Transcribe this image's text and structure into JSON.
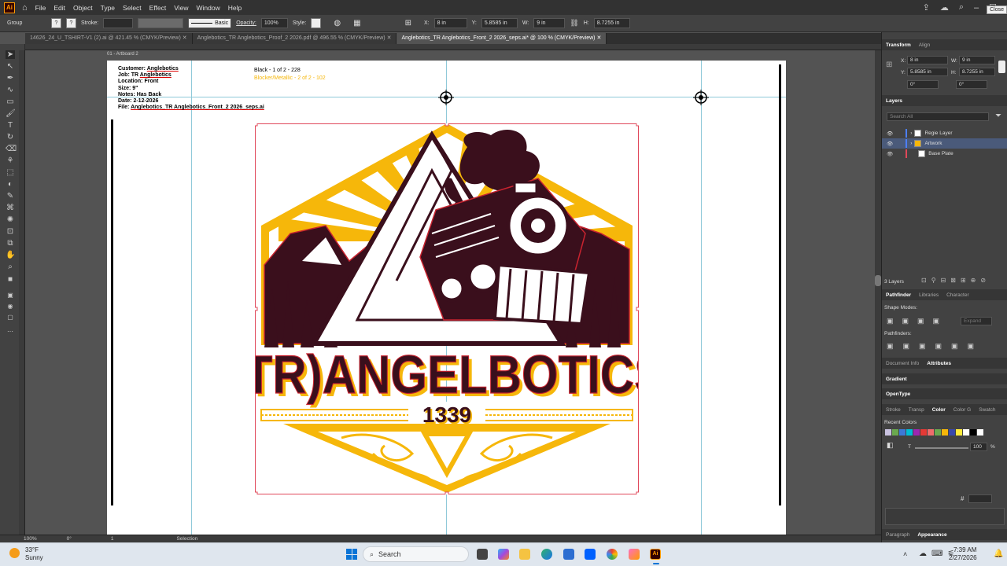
{
  "app": {
    "logo_text": "Ai",
    "menu": [
      "File",
      "Edit",
      "Object",
      "Type",
      "Select",
      "Effect",
      "View",
      "Window",
      "Help"
    ],
    "close_tooltip": "Close"
  },
  "control_bar": {
    "selection_type": "Group",
    "stroke_label": "Stroke:",
    "brush_label": "Basic",
    "opacity_label": "Opacity:",
    "opacity_value": "100%",
    "style_label": "Style:",
    "x_label": "X:",
    "x_value": "8 in",
    "y_label": "Y:",
    "y_value": "5.8585 in",
    "w_label": "W:",
    "w_value": "9 in",
    "h_label": "H:",
    "h_value": "8.7255 in"
  },
  "tabs": [
    "14626_24_U_TSHIRT-V1 (2).ai @ 421.45 % (CMYK/Preview)",
    "Anglebotics_TR Anglebotics_Proof_2 2026.pdf @ 496.55 % (CMYK/Preview)",
    "Anglebotics_TR Anglebotics_Front_2 2026_seps.ai* @ 100 % (CMYK/Preview)"
  ],
  "artboard": {
    "label": "01 - Artboard 2",
    "info": {
      "customer_label": "Customer:",
      "customer": "Anglebotics",
      "job_label": "Job: TR",
      "job": "Anglebotics",
      "location": "Location: Front",
      "size": "Size: 9\"",
      "notes": "Notes: Has Back",
      "date": "Date: 2-12-2026",
      "file_label": "File:",
      "file": "Anglebotics_TR Anglebotics_Front_2 2026_seps.ai"
    },
    "seps": {
      "black": "Black - 1 of 2 - 228",
      "blocker": "Blocker/Metallic - 2 of 2 - 102"
    },
    "design": {
      "title": "(TR)ANGELBOTICS",
      "year": "1339"
    }
  },
  "colors": {
    "ink": "#3a0f1c",
    "gold": "#f6b70a",
    "red_outline": "#c8232f",
    "guide": "#8fc9d9"
  },
  "panel": {
    "transform_tabs": [
      "Transform",
      "Align"
    ],
    "x": "8 in",
    "y": "5.8585 in",
    "w": "9 in",
    "h": "8.7255 in",
    "rot": "0°",
    "shear": "0°",
    "layers_title": "Layers",
    "search_placeholder": "Search All",
    "layers": [
      "Regie Layer",
      "Artwork",
      "Base Plate"
    ],
    "layers_count": "3 Layers",
    "pathfinder_tabs": [
      "Pathfinder",
      "Libraries",
      "Character"
    ],
    "shape_modes": "Shape Modes:",
    "expand": "Expand",
    "pathfinders": "Pathfinders:",
    "doc_tabs": [
      "Document Info",
      "Attributes"
    ],
    "gradient": "Gradient",
    "opentype": "OpenType",
    "color_tabs": [
      "Stroke",
      "Transp",
      "Color",
      "Color G",
      "Swatch"
    ],
    "recent_colors": "Recent Colors",
    "tint_label": "T",
    "tint_value": "100",
    "tint_unit": "%",
    "hash": "#",
    "bottom_tabs": [
      "Paragraph",
      "Appearance"
    ]
  },
  "status": {
    "zoom": "100%",
    "rotation": "0°",
    "artboard_num": "1",
    "tool": "Selection"
  },
  "taskbar": {
    "weather_temp": "33°F",
    "weather_desc": "Sunny",
    "search_label": "Search",
    "time": "7:39 AM",
    "date": "2/27/2026"
  }
}
